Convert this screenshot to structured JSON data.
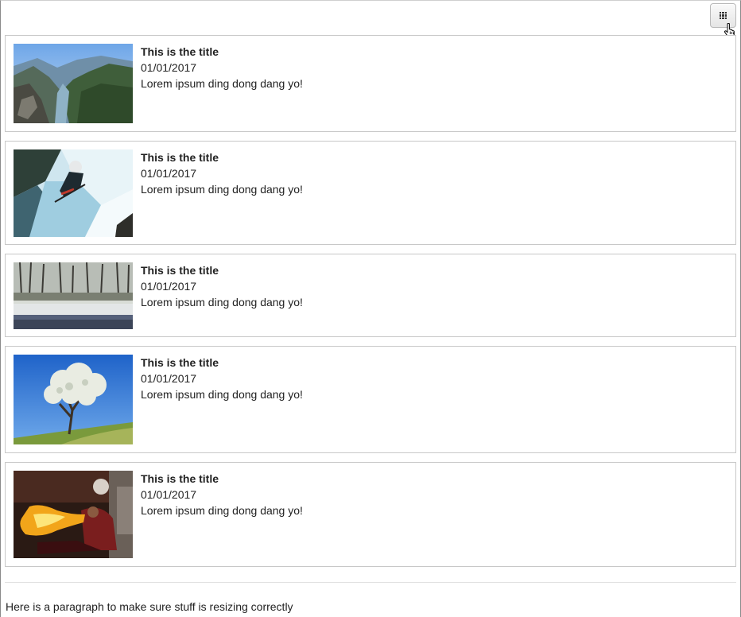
{
  "toolbar": {
    "view_toggle_icon": "grid-icon"
  },
  "items": [
    {
      "title": "This is the title",
      "date": "01/01/2017",
      "body": "Lorem ipsum ding dong dang yo!",
      "image": "fjord-mountain-valley"
    },
    {
      "title": "This is the title",
      "date": "01/01/2017",
      "body": "Lorem ipsum ding dong dang yo!",
      "image": "whitewater-kayaker"
    },
    {
      "title": "This is the title",
      "date": "01/01/2017",
      "body": "Lorem ipsum ding dong dang yo!",
      "image": "winter-lake-trees"
    },
    {
      "title": "This is the title",
      "date": "01/01/2017",
      "body": "Lorem ipsum ding dong dang yo!",
      "image": "blossoming-tree-blue-sky"
    },
    {
      "title": "This is the title",
      "date": "01/01/2017",
      "body": "Lorem ipsum ding dong dang yo!",
      "image": "fire-breather"
    }
  ],
  "footer": {
    "paragraph": "Here is a paragraph to make sure stuff is resizing correctly"
  }
}
